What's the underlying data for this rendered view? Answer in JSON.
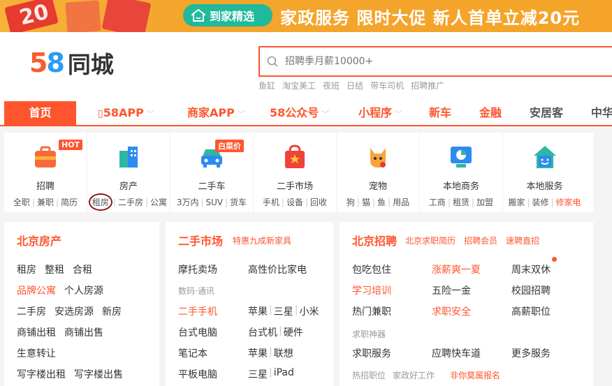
{
  "banner": {
    "coupon_text": "20",
    "pill_label": "到家精选",
    "headline": "家政服务  限时大促  新人首单立减20元"
  },
  "header": {
    "logo_number_a": "5",
    "logo_number_b": "8",
    "logo_name": "同城",
    "search_placeholder": "招聘季月薪10000+",
    "hot_words": [
      "鱼缸",
      "淘宝美工",
      "夜班",
      "日结",
      "带车司机",
      "招聘推广"
    ]
  },
  "nav": {
    "home": "首页",
    "items": [
      "58APP",
      "商家APP",
      "58公众号",
      "小程序",
      "新车",
      "金融",
      "安居客",
      "中华"
    ]
  },
  "categories": [
    {
      "title": "招聘",
      "badge": "HOT",
      "subs": [
        "全职",
        "兼职",
        "简历"
      ]
    },
    {
      "title": "房产",
      "subs": [
        "租房",
        "二手房",
        "公寓"
      ]
    },
    {
      "title": "二手车",
      "badge": "白菜价",
      "subs": [
        "3万内",
        "SUV",
        "货车"
      ]
    },
    {
      "title": "二手市场",
      "subs": [
        "手机",
        "设备",
        "回收"
      ]
    },
    {
      "title": "宠物",
      "subs": [
        "狗",
        "猫",
        "鱼",
        "用品"
      ]
    },
    {
      "title": "本地商务",
      "subs": [
        "工商",
        "租赁",
        "加盟"
      ]
    },
    {
      "title": "本地服务",
      "subs": [
        "搬家",
        "装修",
        "修家电"
      ]
    }
  ],
  "panel_house": {
    "title": "北京房产",
    "rows": [
      [
        "租房",
        "整租",
        "合租"
      ],
      [
        "品牌公寓",
        "个人房源"
      ],
      [
        "二手房",
        "安选房源",
        "新房"
      ],
      [
        "商铺出租",
        "商铺出售"
      ],
      [
        "生意转让"
      ],
      [
        "写字楼出租",
        "写字楼出售"
      ]
    ]
  },
  "panel_market": {
    "title": "二手市场",
    "subtitle": "特惠九成新家具",
    "rows": [
      {
        "left": "摩托卖场",
        "right": "高性价比家电"
      },
      {
        "left_label": "数码·通讯"
      },
      {
        "left": "二手手机",
        "right": [
          "苹果",
          "三星",
          "小米"
        ]
      },
      {
        "left": "台式电脑",
        "right": [
          "台式机",
          "硬件"
        ]
      },
      {
        "left": "笔记本",
        "right": [
          "苹果",
          "联想"
        ]
      },
      {
        "left": "平板电脑",
        "right": [
          "三星",
          "iPad"
        ]
      }
    ]
  },
  "panel_jobs": {
    "title": "北京招聘",
    "links": [
      "北京求职简历",
      "招聘会员",
      "速聘直招"
    ],
    "grid": [
      [
        "包吃包住",
        "涨薪爽一夏",
        "周末双休"
      ],
      [
        "学习培训",
        "五险一金",
        "校园招聘"
      ],
      [
        "热门兼职",
        "求职安全",
        "高薪职位"
      ]
    ],
    "section_label": "求职神器",
    "services": [
      "求职服务",
      "应聘快车道",
      "更多服务"
    ],
    "hot_label": "热招职位",
    "hot_items": [
      "家政好工作",
      "非你莫属报名"
    ]
  },
  "colors": {
    "accent": "#ff552e",
    "banner": "#f5a42a",
    "teal": "#20b99c"
  }
}
